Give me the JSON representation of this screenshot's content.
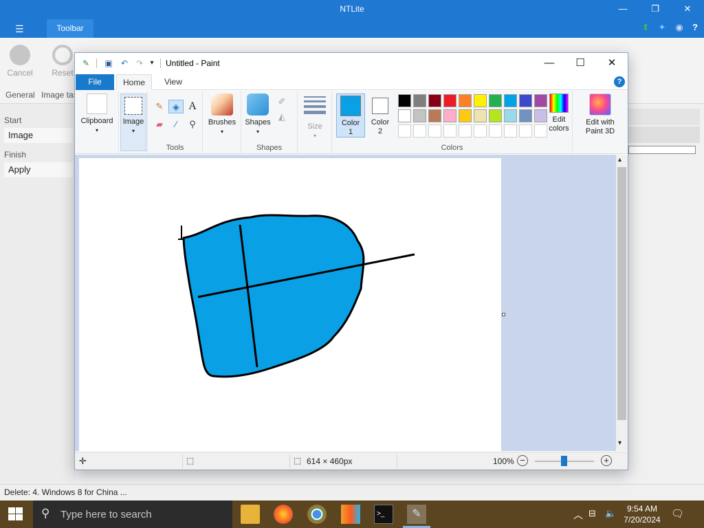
{
  "ntlite": {
    "title": "NTLite",
    "tab": "Toolbar",
    "ribbon": {
      "cancel": "Cancel",
      "reset": "Reset",
      "group_general": "General",
      "group_image_tasks": "Image tas"
    },
    "sidebar": {
      "start": "Start",
      "image": "Image",
      "finish": "Finish",
      "apply": "Apply"
    },
    "status": "Delete: 4. Windows 8 for China ..."
  },
  "paint": {
    "title": "Untitled - Paint",
    "tabs": {
      "file": "File",
      "home": "Home",
      "view": "View"
    },
    "groups": {
      "tools": "Tools",
      "shapes": "Shapes",
      "colors": "Colors"
    },
    "buttons": {
      "clipboard": "Clipboard",
      "image": "Image",
      "brushes": "Brushes",
      "shapes": "Shapes",
      "size": "Size",
      "color1_a": "Color",
      "color1_b": "1",
      "color2_a": "Color",
      "color2_b": "2",
      "edit_colors_a": "Edit",
      "edit_colors_b": "colors",
      "paint3d_a": "Edit with",
      "paint3d_b": "Paint 3D"
    },
    "color1": "#0aa0e6",
    "color2": "#ffffff",
    "palette_row1": [
      "#000000",
      "#7f7f7f",
      "#880015",
      "#ed1c24",
      "#ff7f27",
      "#fff200",
      "#22b14c",
      "#00a2e8",
      "#3f48cc",
      "#a349a4"
    ],
    "palette_row2": [
      "#ffffff",
      "#c3c3c3",
      "#b97a57",
      "#ffaec9",
      "#ffc90e",
      "#efe4b0",
      "#b5e61d",
      "#99d9ea",
      "#7092be",
      "#c8bfe7"
    ],
    "status": {
      "size": "614 × 460px",
      "zoom": "100%"
    }
  },
  "taskbar": {
    "search_placeholder": "Type here to search",
    "time": "9:54 AM",
    "date": "7/20/2024"
  }
}
